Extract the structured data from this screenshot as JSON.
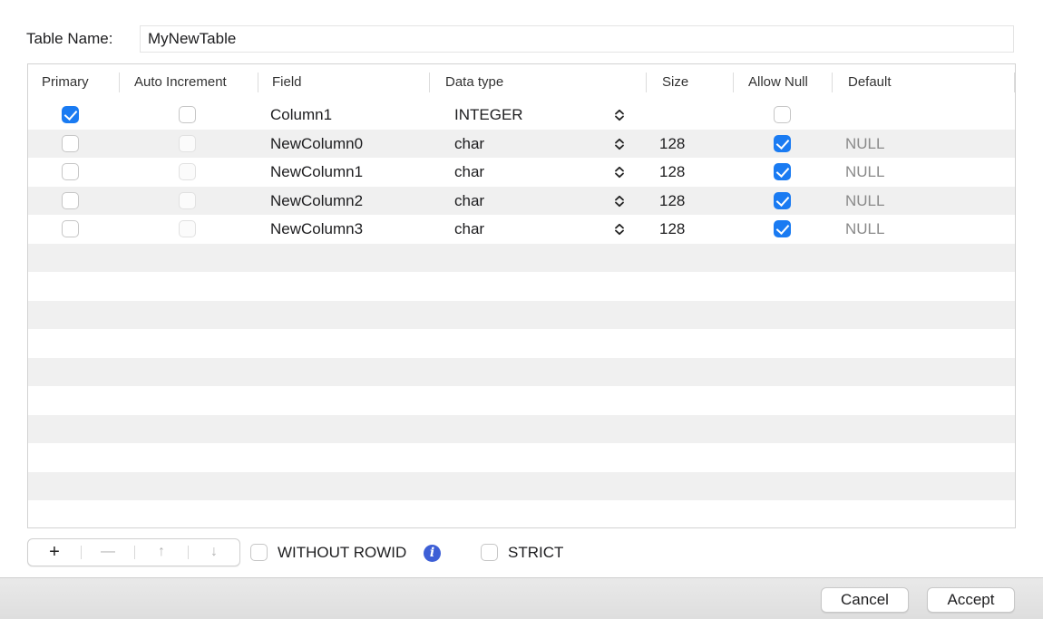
{
  "table_name": {
    "label": "Table Name:",
    "value": "MyNewTable"
  },
  "columns_header": {
    "primary": "Primary",
    "auto_increment": "Auto Increment",
    "field": "Field",
    "data_type": "Data type",
    "size": "Size",
    "allow_null": "Allow Null",
    "default": "Default"
  },
  "rows": [
    {
      "primary": true,
      "auto_increment": false,
      "field": "Column1",
      "data_type": "INTEGER",
      "size": "",
      "allow_null": false,
      "default": ""
    },
    {
      "primary": false,
      "auto_increment": false,
      "field": "NewColumn0",
      "data_type": "char",
      "size": "128",
      "allow_null": true,
      "default": "NULL"
    },
    {
      "primary": false,
      "auto_increment": false,
      "field": "NewColumn1",
      "data_type": "char",
      "size": "128",
      "allow_null": true,
      "default": "NULL"
    },
    {
      "primary": false,
      "auto_increment": false,
      "field": "NewColumn2",
      "data_type": "char",
      "size": "128",
      "allow_null": true,
      "default": "NULL"
    },
    {
      "primary": false,
      "auto_increment": false,
      "field": "NewColumn3",
      "data_type": "char",
      "size": "128",
      "allow_null": true,
      "default": "NULL"
    }
  ],
  "toolbar": {
    "add_glyph": "+",
    "remove_glyph": "—",
    "up_glyph": "↑",
    "down_glyph": "↓"
  },
  "options": {
    "without_rowid": {
      "label": "WITHOUT ROWID",
      "checked": false
    },
    "info_glyph": "i",
    "strict": {
      "label": "STRICT",
      "checked": false
    }
  },
  "footer": {
    "cancel_label": "Cancel",
    "accept_label": "Accept"
  },
  "colors": {
    "accent": "#1a7bf2",
    "info": "#3d5fd6",
    "stripe": "#f0f0f0"
  }
}
